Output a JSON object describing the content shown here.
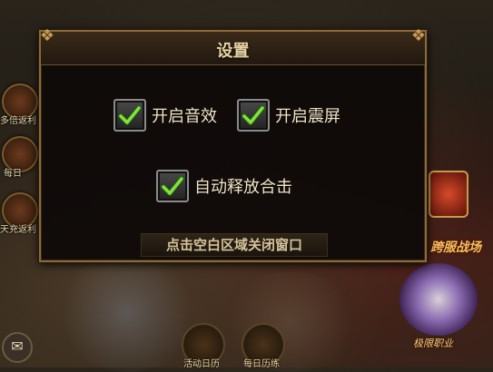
{
  "dialog": {
    "title": "设置",
    "options": [
      {
        "label": "开启音效",
        "checked": true
      },
      {
        "label": "开启震屏",
        "checked": true
      },
      {
        "label": "自动释放合击",
        "checked": true
      }
    ],
    "close_hint": "点击空白区域关闭窗口"
  },
  "background": {
    "left_side_labels": [
      "多倍返利",
      "每日",
      "天充返利"
    ],
    "bottom_labels": [
      "活动日历",
      "每日历练"
    ],
    "war_label": "跨服战场",
    "event_label": "极限职业",
    "mail_icon": "envelope-icon",
    "colors": {
      "accent_gold": "#c89a52",
      "check_green": "#7ed63a",
      "text_cream": "#f2e4c6"
    }
  }
}
